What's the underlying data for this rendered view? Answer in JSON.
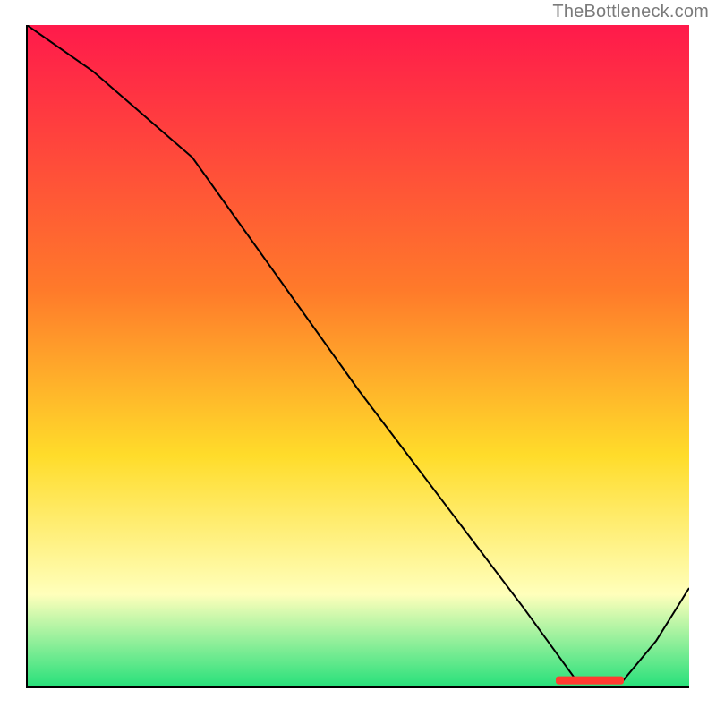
{
  "watermark": "TheBottleneck.com",
  "colors": {
    "gradient_top": "#ff1a4b",
    "gradient_orange": "#ff7a2a",
    "gradient_yellow": "#ffdc2a",
    "gradient_pale": "#ffffbb",
    "gradient_green": "#26e07a",
    "curve": "#000000",
    "marker": "#ff3b30"
  },
  "chart_data": {
    "type": "line",
    "title": "",
    "xlabel": "",
    "ylabel": "",
    "xlim": [
      0,
      100
    ],
    "ylim": [
      0,
      100
    ],
    "grid": false,
    "legend": false,
    "x": [
      0,
      10,
      25,
      50,
      75,
      83,
      90,
      95,
      100
    ],
    "values": [
      100,
      93,
      80,
      45,
      12,
      1,
      1,
      7,
      15
    ],
    "min_region": {
      "x_start": 80,
      "x_end": 90,
      "value": 1
    }
  }
}
